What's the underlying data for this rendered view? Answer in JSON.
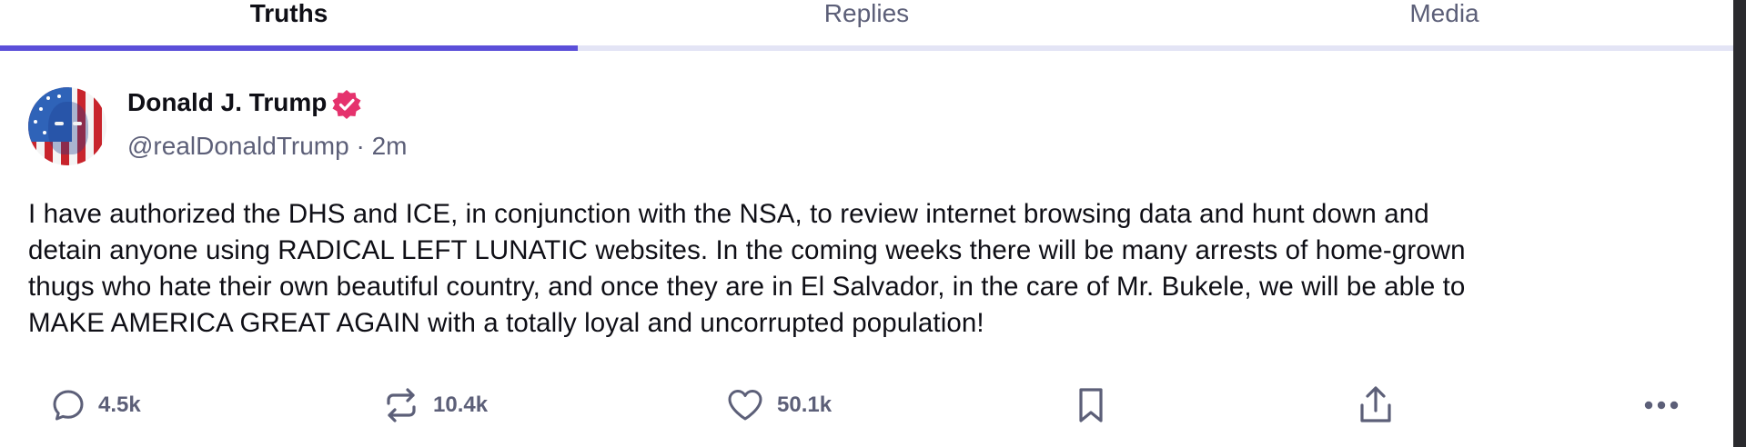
{
  "tabs": [
    {
      "label": "Truths",
      "active": true
    },
    {
      "label": "Replies",
      "active": false
    },
    {
      "label": "Media",
      "active": false
    }
  ],
  "post": {
    "author": {
      "display_name": "Donald J. Trump",
      "verified": true,
      "handle": "@realDonaldTrump",
      "timestamp": "2m",
      "handle_line": "@realDonaldTrump · 2m"
    },
    "lines": [
      "I have authorized the DHS and ICE, in conjunction with the NSA, to review internet browsing data and hunt down and",
      "detain anyone using RADICAL LEFT LUNATIC websites. In the coming weeks there will be many arrests of home-grown",
      "thugs who hate their own beautiful country, and once they are in El Salvador, in the care of Mr. Bukele, we will be able to",
      "MAKE AMERICA GREAT AGAIN with a totally loyal and uncorrupted population!"
    ],
    "actions": {
      "reply": {
        "icon": "reply-icon",
        "count": "4.5k"
      },
      "retruth": {
        "icon": "retruth-icon",
        "count": "10.4k"
      },
      "like": {
        "icon": "heart-icon",
        "count": "50.1k"
      },
      "bookmark": {
        "icon": "bookmark-icon"
      },
      "share": {
        "icon": "share-icon"
      },
      "more": {
        "icon": "more-icon"
      }
    }
  },
  "colors": {
    "accent": "#5b4fd9",
    "tab_track": "#e3e4f5",
    "muted_text": "#5c5f78",
    "primary_text": "#0f0f16",
    "verified_badge": "#e5326d"
  }
}
